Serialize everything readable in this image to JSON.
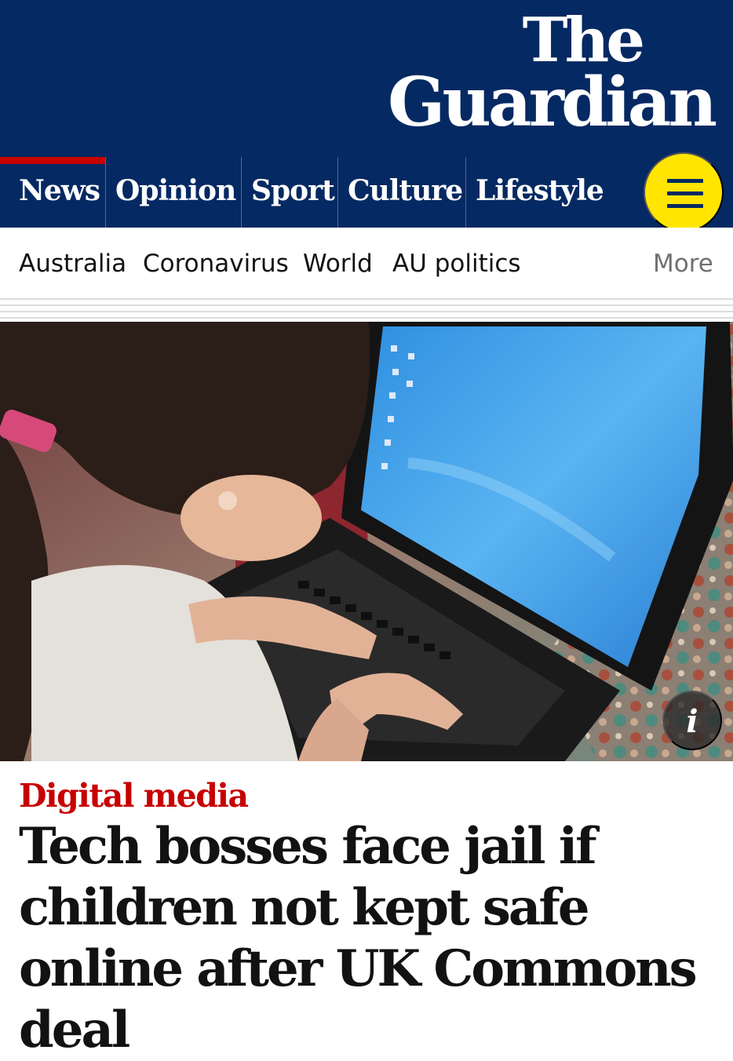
{
  "masthead": {
    "logo_line1": "The",
    "logo_line2": "Guardian",
    "background_color": "#052962"
  },
  "pillars": [
    {
      "label": "News",
      "active": true
    },
    {
      "label": "Opinion",
      "active": false
    },
    {
      "label": "Sport",
      "active": false
    },
    {
      "label": "Culture",
      "active": false
    },
    {
      "label": "Lifestyle",
      "active": false
    }
  ],
  "menu_button": {
    "icon": "hamburger-menu-icon",
    "color": "#ffe500"
  },
  "subnav": {
    "items": [
      "Australia",
      "Coronavirus",
      "World",
      "AU politics"
    ],
    "more": "More"
  },
  "hero": {
    "info_label": "i"
  },
  "article": {
    "kicker": "Digital media",
    "kicker_color": "#c70000",
    "headline": "Tech bosses face jail if children not kept safe online after UK Commons deal"
  }
}
